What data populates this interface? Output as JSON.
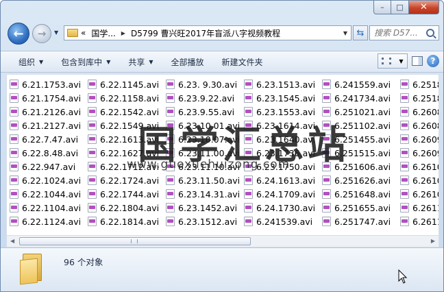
{
  "window": {
    "minimize_label": "–",
    "maximize_label": "□",
    "close_label": "✕"
  },
  "nav": {
    "back_label": "←",
    "forward_label": "→",
    "breadcrumb": [
      {
        "label": "«"
      },
      {
        "label": "国学..."
      },
      {
        "label": "D5799 曹兴旺2017年盲派八字视频教程"
      }
    ],
    "search_placeholder": "搜索 D57..."
  },
  "toolbar": {
    "organize": "组织",
    "include_in_library": "包含到库中",
    "share": "共享",
    "play_all": "全部播放",
    "new_folder": "新建文件夹"
  },
  "files": [
    "6.21.1753.avi",
    "6.21.1754.avi",
    "6.21.2126.avi",
    "6.21.2127.avi",
    "6.22.7.47.avi",
    "6.22.8.48.avi",
    "6.22.947.avi",
    "6.22.1024.avi",
    "6.22.1044.avi",
    "6.22.1104.avi",
    "6.22.1124.avi",
    "6.22.1145.avi",
    "6.22.1158.avi",
    "6.22.1542.avi",
    "6.22.1549.avi",
    "6.22.1613.avi",
    "6.22.1627.avi",
    "6.22.1712.avi",
    "6.22.1724.avi",
    "6.22.1744.avi",
    "6.22.1804.avi",
    "6.22.1814.avi",
    "6.23. 9.30.avi",
    "6.23.9.22.avi",
    "6.23.9.55.avi",
    "6.23.10.01.avi",
    "6.23.10.07.avi",
    "6.23.11.00.avi",
    "6.23.11.10.avi",
    "6.23.11.50.avi",
    "6.23.14.31.avi",
    "6.23.1452.avi",
    "6.23.1512.avi",
    "6.23.1513.avi",
    "6.23.1545.avi",
    "6.23.1553.avi",
    "6.23.1614.avi",
    "6.23.1640.avi",
    "6.23.1736.avi",
    "6.23.1750.avi",
    "6.24.1613.avi",
    "6.24.1709.avi",
    "6.24.1730.avi",
    "6.241539.avi",
    "6.241559.avi",
    "6.241734.avi",
    "6.251021.avi",
    "6.251102.avi",
    "6.251455.avi",
    "6.251515.avi",
    "6.251606.avi",
    "6.251626.avi",
    "6.251648.avi",
    "6.251655.avi",
    "6.251747.avi",
    "6.2518",
    "6.2518",
    "6.2608",
    "6.2608",
    "6.2609",
    "6.2609",
    "6.2610",
    "6.2610",
    "6.2610",
    "6.2611",
    "6.2611"
  ],
  "details": {
    "count_text": "96 个对象"
  },
  "watermark": {
    "cn": "国学汇总站",
    "url": "www.guoxuehuizong.com"
  },
  "colors": {
    "avi_icon": "#b34fbf",
    "close_button": "#c9452a"
  }
}
